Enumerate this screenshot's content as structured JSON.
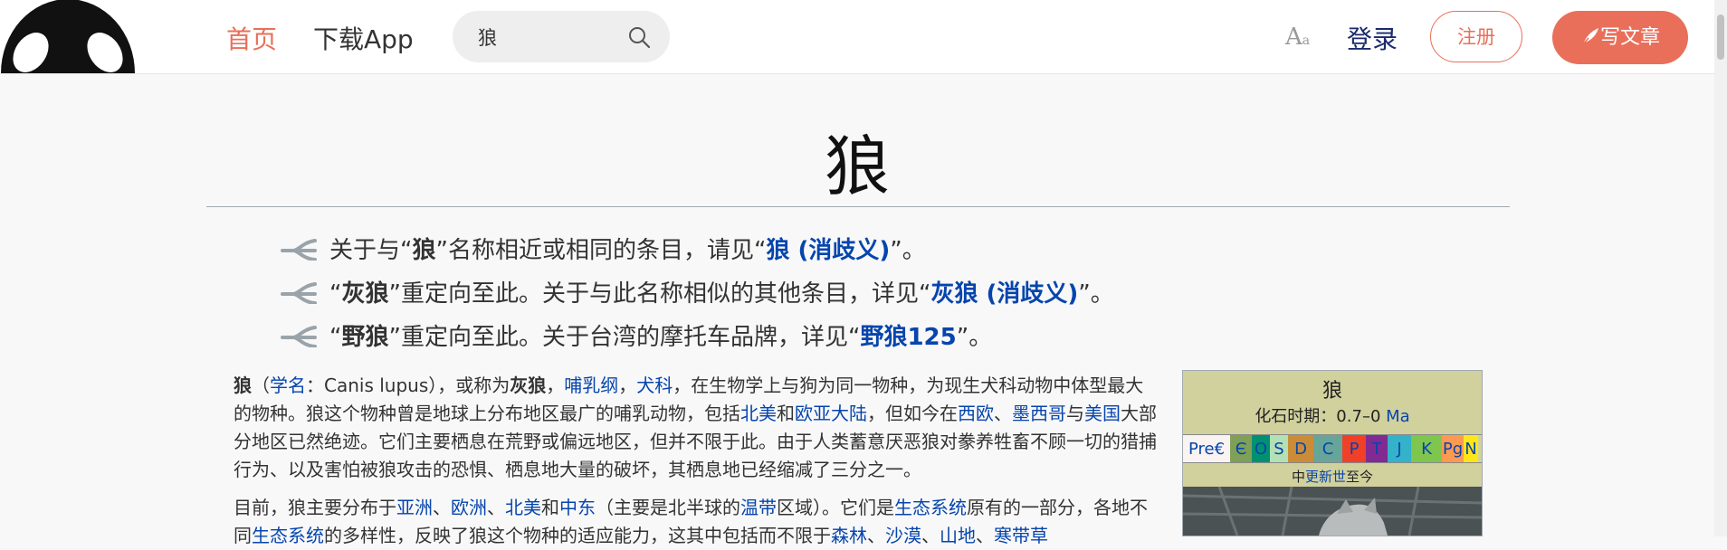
{
  "header": {
    "nav_home": "首页",
    "nav_app": "下载App",
    "search_value": "狼",
    "font_toggle": "A",
    "font_toggle_small": "a",
    "login": "登录",
    "signup": "注册",
    "write": "写文章",
    "accent_color": "#ea6f5a"
  },
  "article": {
    "title": "狼",
    "hatnotes": [
      {
        "pre": "关于与“",
        "bold": "狼",
        "mid": "”名称相近或相同的条目，请见“",
        "link": "狼 (消歧义)",
        "post": "”。"
      },
      {
        "pre": "“",
        "bold": "灰狼",
        "mid": "”重定向至此。关于与此名称相似的其他条目，详见“",
        "link": "灰狼 (消歧义)",
        "post": "”。"
      },
      {
        "pre": "“",
        "bold": "野狼",
        "mid": "”重定向至此。关于台湾的摩托车品牌，详见“",
        "link": "野狼125",
        "post": "”。"
      }
    ],
    "p1": {
      "t1": "狼",
      "t2": "（",
      "l_xueming": "学名",
      "t3": "：Canis lupus），或称为",
      "t4": "灰狼",
      "t5": "，",
      "l_burugang": "哺乳纲",
      "t6": "，",
      "l_quanke": "犬科",
      "t7": "，在生物学上与狗为同一物种，为现生犬科动物中体型最大的物种。狼这个物种曾是地球上分布地区最广的哺乳动物，包括",
      "l_beimei": "北美",
      "t8": "和",
      "l_ouya": "欧亚大陆",
      "t9": "，但如今在",
      "l_xiou": "西欧",
      "t10": "、",
      "l_moxige": "墨西哥",
      "t11": "与",
      "l_meiguo": "美国",
      "t12": "大部分地区已然绝迹。它们主要栖息在荒野或偏远地区，但并不限于此。由于人类蓄意厌恶狼对豢养牲畜不顾一切的猎捕行为、以及害怕被狼攻击的恐惧、栖息地大量的破坏，其栖息地已经缩减了三分之一。"
    },
    "p2": {
      "t1": "目前，狼主要分布于",
      "l_yazhou": "亚洲",
      "t2": "、",
      "l_ouzhou": "欧洲",
      "t3": "、",
      "l_beimei": "北美",
      "t4": "和",
      "l_zhongdong": "中东",
      "t5": "（主要是北半球的",
      "l_wendai": "温带",
      "t6": "区域）。它们是",
      "l_shengtai": "生态系统",
      "t7": "原有的一部分，各地不同",
      "l_shengtai2": "生态系统",
      "t8": "的多样性，反映了狼这个物种的适应能力，这其中包括而不限于",
      "l_senlin": "森林",
      "t9": "、",
      "l_shamo": "沙漠",
      "t10": "、",
      "l_shandi": "山地",
      "t11": "、",
      "l_handai": "寒带草"
    }
  },
  "infobox": {
    "title": "狼",
    "fossil_label": "化石时期：0.7–0 ",
    "fossil_unit": "Ma",
    "periods": [
      {
        "label": "Pre€",
        "color": "#f9f3f1"
      },
      {
        "label": "Є",
        "color": "#7fa056"
      },
      {
        "label": "O",
        "color": "#009270"
      },
      {
        "label": "S",
        "color": "#b3e1b6"
      },
      {
        "label": "D",
        "color": "#cb8c37"
      },
      {
        "label": "C",
        "color": "#67a599"
      },
      {
        "label": "P",
        "color": "#f04028"
      },
      {
        "label": "T",
        "color": "#812b92"
      },
      {
        "label": "J",
        "color": "#34b2c9"
      },
      {
        "label": "K",
        "color": "#7fc64e"
      },
      {
        "label": "Pg",
        "color": "#fd9a52"
      },
      {
        "label": "N",
        "color": "#ffe619"
      }
    ],
    "holocene_pre": "中",
    "holocene_link": "更新世",
    "holocene_post": "至今"
  }
}
